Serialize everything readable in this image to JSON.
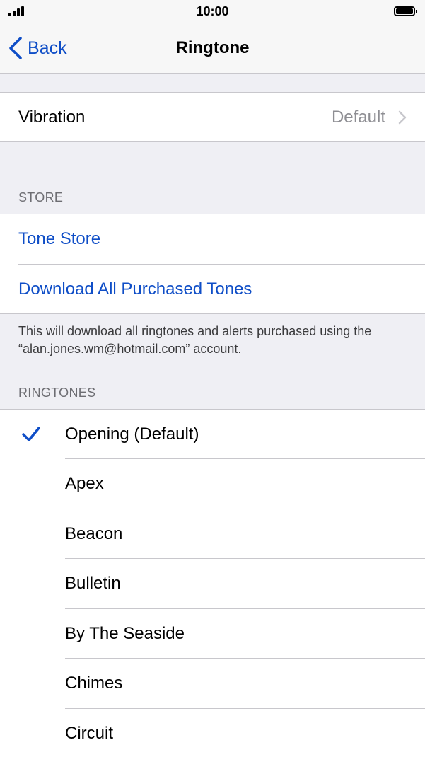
{
  "status": {
    "time": "10:00"
  },
  "nav": {
    "back_label": "Back",
    "title": "Ringtone"
  },
  "vibration": {
    "label": "Vibration",
    "value": "Default"
  },
  "store": {
    "header": "STORE",
    "tone_store": "Tone Store",
    "download_all": "Download All Purchased Tones",
    "footer": "This will download all ringtones and alerts purchased using the “alan.jones.wm@hotmail.com” account."
  },
  "ringtones": {
    "header": "RINGTONES",
    "selected": "Opening (Default)",
    "items": [
      "Opening (Default)",
      "Apex",
      "Beacon",
      "Bulletin",
      "By The Seaside",
      "Chimes",
      "Circuit"
    ]
  },
  "colors": {
    "accent": "#0f4ec7",
    "background": "#efeff4"
  }
}
